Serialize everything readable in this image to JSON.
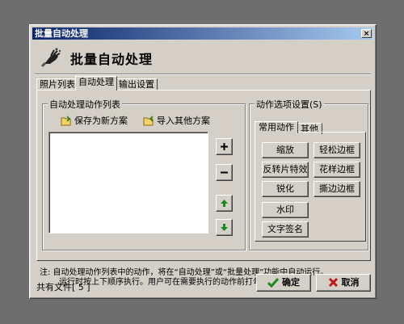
{
  "window": {
    "title": "批量自动处理",
    "close_glyph": "×",
    "header_title": "批量自动处理",
    "header_icon": "wand-hand-icon"
  },
  "tabs": [
    {
      "label": "照片列表",
      "active": false
    },
    {
      "label": "自动处理",
      "active": true
    },
    {
      "label": "输出设置",
      "active": false
    }
  ],
  "left_group": {
    "title": "自动处理动作列表",
    "save_label": "保存为新方案",
    "import_label": "导入其他方案",
    "side_buttons": [
      {
        "icon": "plus-icon",
        "glyph": "+"
      },
      {
        "icon": "minus-icon",
        "glyph": "−"
      },
      {
        "icon": "arrow-up-icon",
        "glyph": "▲"
      },
      {
        "icon": "arrow-down-icon",
        "glyph": "▼"
      }
    ]
  },
  "right_group": {
    "title": "动作选项设置(S)",
    "subtabs": [
      {
        "label": "常用动作",
        "active": true
      },
      {
        "label": "其他",
        "active": false
      }
    ],
    "actions": {
      "scale": "缩放",
      "easy_border": "轻松边框",
      "invert_effect": "反转片特效",
      "fancy_border": "花样边框",
      "sharpen": "锐化",
      "torn_border": "撕边边框",
      "watermark": "水印",
      "text_signature": "文字签名"
    }
  },
  "note": {
    "line1": "注: 自动处理动作列表中的动作，将在“自动处理”或“批量处理”功能中自动运行。",
    "line2": "运行时按上下顺序执行。用户可在需要执行的动作前打勾。"
  },
  "status": {
    "text": "共有文件[ 5 ]"
  },
  "buttons": {
    "ok": "确定",
    "cancel": "取消"
  }
}
